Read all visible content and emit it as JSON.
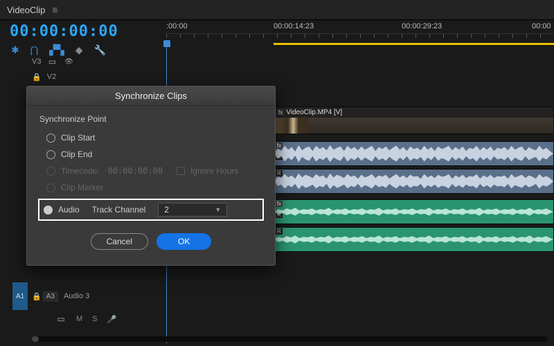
{
  "panel": {
    "title": "VideoClip"
  },
  "timecode": {
    "main": "00:00:00:00"
  },
  "ruler": {
    "m0": ":00:00",
    "m1": "00:00:14:23",
    "m2": "00:00:29:23",
    "m3": "00:00"
  },
  "tracks": {
    "v3": "V3",
    "v2": "V2",
    "a1": "A1",
    "a3_badge": "A3",
    "a3_label": "Audio 3",
    "mix": {
      "m": "M",
      "s": "S"
    }
  },
  "clips": {
    "video_label": "VideoClip.MP4 [V]",
    "ch_l": "L",
    "ch_r": "R"
  },
  "dialog": {
    "title": "Synchronize Clips",
    "section": "Synchronize Point",
    "opt_start": "Clip Start",
    "opt_end": "Clip End",
    "opt_tc": "Timecode:",
    "tc_value": "00:00:00:00",
    "ignore_hours": "Ignore Hours",
    "opt_marker": "Clip Marker",
    "opt_audio": "Audio",
    "track_channel": "Track Channel",
    "channel_value": "2",
    "cancel": "Cancel",
    "ok": "OK"
  }
}
